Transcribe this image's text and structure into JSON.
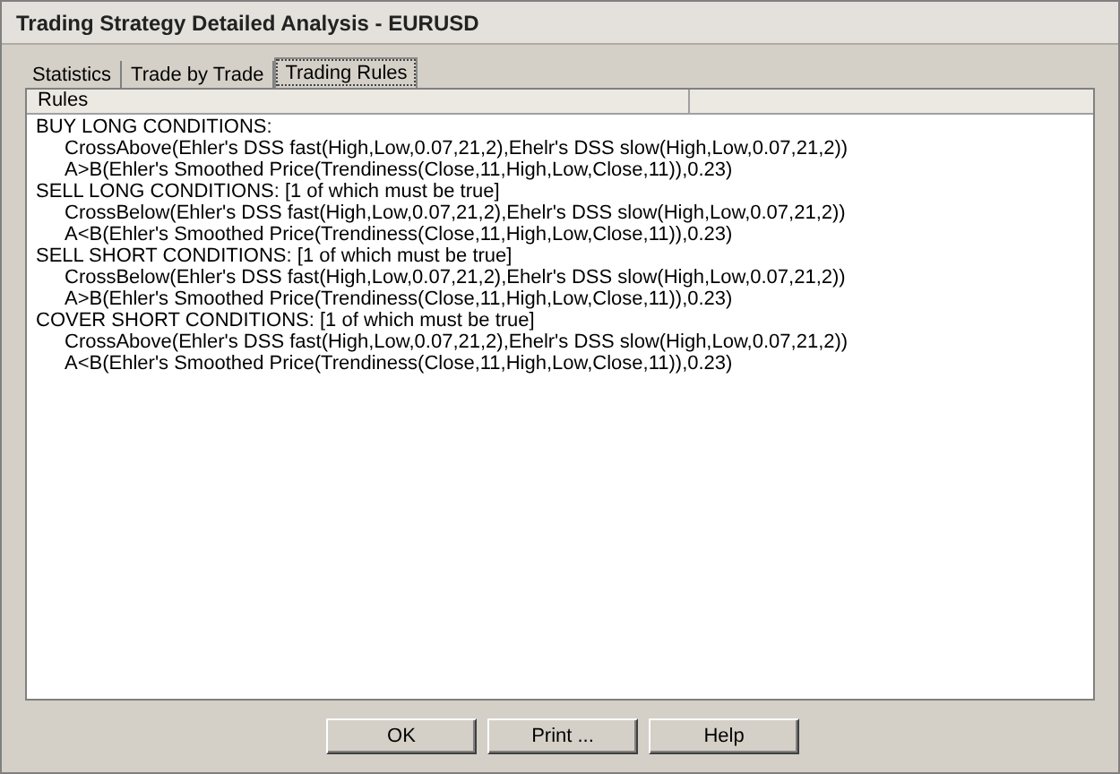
{
  "window": {
    "title": "Trading Strategy Detailed Analysis - EURUSD"
  },
  "tabs": [
    {
      "label": "Statistics",
      "selected": false
    },
    {
      "label": "Trade by Trade",
      "selected": false
    },
    {
      "label": "Trading Rules",
      "selected": true
    }
  ],
  "table": {
    "columns": [
      "Rules"
    ],
    "rows": [
      {
        "text": "BUY LONG CONDITIONS:",
        "children": [
          {
            "text": "CrossAbove(Ehler's DSS fast(High,Low,0.07,21,2),Ehelr's DSS slow(High,Low,0.07,21,2))"
          },
          {
            "text": "A>B(Ehler's Smoothed Price(Trendiness(Close,11,High,Low,Close,11)),0.23)"
          }
        ]
      },
      {
        "text": "SELL LONG CONDITIONS: [1 of which must be true]",
        "children": [
          {
            "text": "CrossBelow(Ehler's DSS fast(High,Low,0.07,21,2),Ehelr's DSS slow(High,Low,0.07,21,2))"
          },
          {
            "text": "A<B(Ehler's Smoothed Price(Trendiness(Close,11,High,Low,Close,11)),0.23)"
          }
        ]
      },
      {
        "text": "SELL SHORT CONDITIONS: [1 of which must be true]",
        "children": [
          {
            "text": "CrossBelow(Ehler's DSS fast(High,Low,0.07,21,2),Ehelr's DSS slow(High,Low,0.07,21,2))"
          },
          {
            "text": "A>B(Ehler's Smoothed Price(Trendiness(Close,11,High,Low,Close,11)),0.23)"
          }
        ]
      },
      {
        "text": "COVER SHORT CONDITIONS: [1 of which must be true]",
        "children": [
          {
            "text": "CrossAbove(Ehler's DSS fast(High,Low,0.07,21,2),Ehelr's DSS slow(High,Low,0.07,21,2))"
          },
          {
            "text": "A<B(Ehler's Smoothed Price(Trendiness(Close,11,High,Low,Close,11)),0.23)"
          }
        ]
      }
    ]
  },
  "buttons": [
    "OK",
    "Print ...",
    "Help"
  ]
}
